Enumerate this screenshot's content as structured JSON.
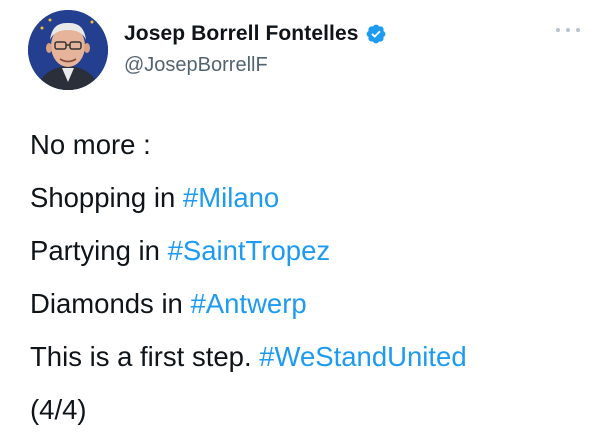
{
  "author": {
    "display_name": "Josep Borrell Fontelles",
    "handle": "@JosepBorrellF",
    "verified": true
  },
  "menu_icon": "more-horizontal-icon",
  "tweet": {
    "lines": [
      {
        "text": "No more :",
        "hashtag": ""
      },
      {
        "text": "Shopping in ",
        "hashtag": "#Milano"
      },
      {
        "text": "Partying in ",
        "hashtag": "#SaintTropez"
      },
      {
        "text": "Diamonds in ",
        "hashtag": "#Antwerp"
      },
      {
        "text": "This is a first step. ",
        "hashtag": "#WeStandUnited"
      },
      {
        "text": "(4/4)",
        "hashtag": ""
      }
    ]
  },
  "colors": {
    "text": "#0f1419",
    "secondary": "#536471",
    "link": "#1d9bf0",
    "verified_badge": "#1d9bf0"
  }
}
